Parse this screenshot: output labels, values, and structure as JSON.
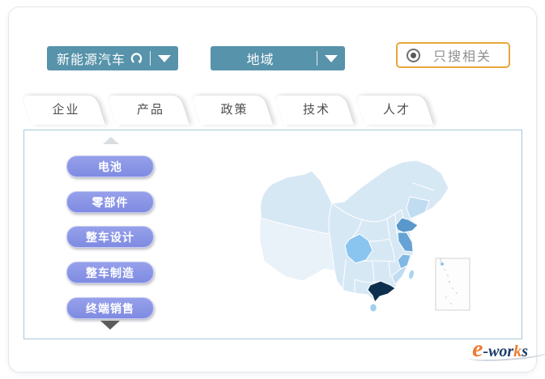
{
  "toolbar": {
    "category_dropdown": {
      "label": "新能源汽车",
      "color": "#5793aa"
    },
    "region_dropdown": {
      "label": "地域",
      "color": "#5793aa"
    },
    "related_only_toggle": {
      "label": "只搜相关",
      "selected": true,
      "border_color": "#eaa63c"
    }
  },
  "tabs": [
    {
      "label": "企业",
      "active": true
    },
    {
      "label": "产品",
      "active": false
    },
    {
      "label": "政策",
      "active": false
    },
    {
      "label": "技术",
      "active": false
    },
    {
      "label": "人才",
      "active": false
    }
  ],
  "category_list": {
    "button_color": "#8792e6",
    "scroll_up_enabled": false,
    "scroll_down_enabled": true,
    "items": [
      {
        "label": "电池"
      },
      {
        "label": "零部件"
      },
      {
        "label": "整车设计"
      },
      {
        "label": "整车制造"
      },
      {
        "label": "终端销售"
      }
    ]
  },
  "map": {
    "type": "choropleth",
    "subject": "china-provinces",
    "fills": {
      "base": "#d7e8f5",
      "tibet": "#e9f1f9",
      "northwest": "#dcebf7",
      "sichuan": "#8ac5ef",
      "shandong": "#5898cc",
      "jiangsu": "#66a3d4",
      "zhejiang": "#7fb9e4",
      "fujian": "#bfdcf1",
      "liaoning": "#bfdcf1",
      "guangdong": "#0e2f4d",
      "hainan": "#9fd0ee",
      "taiwan": "#aad3ef",
      "border": "#ffffff",
      "inset_bg": "#fdfdfe",
      "inset_border": "#d9d9d9",
      "inset_dot": "#d3dbe1",
      "inset_blue_dot": "#8fc3e8"
    },
    "highlighted_regions": [
      {
        "region": "guangdong",
        "intensity": "highest"
      },
      {
        "region": "shandong",
        "intensity": "high"
      },
      {
        "region": "jiangsu",
        "intensity": "high"
      },
      {
        "region": "sichuan",
        "intensity": "medium"
      },
      {
        "region": "zhejiang",
        "intensity": "medium"
      },
      {
        "region": "fujian",
        "intensity": "low-medium"
      },
      {
        "region": "liaoning",
        "intensity": "low-medium"
      },
      {
        "region": "hainan",
        "intensity": "low-medium"
      },
      {
        "region": "taiwan",
        "intensity": "low"
      }
    ]
  },
  "logo": {
    "e": "e",
    "middle": "-wor",
    "accent": "k",
    "suffix": "s",
    "orange": "#ee7c2f",
    "navy": "#1d3d6b"
  }
}
